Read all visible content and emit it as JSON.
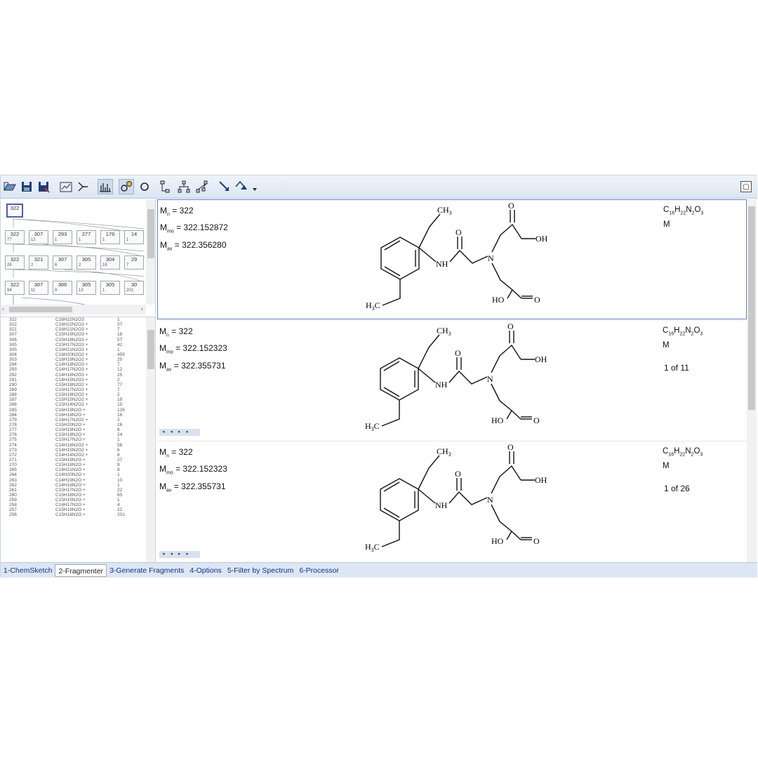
{
  "toolbar": {
    "icons": [
      "open-icon",
      "save-icon",
      "save-as-icon",
      "report-icon",
      "structure-icon",
      "spectrum-icon",
      "fragment-icon",
      "rotate-icon",
      "tree-icon",
      "hierarchy-icon",
      "network-icon",
      "arrow-down-icon",
      "arrow-tri-icon",
      "more-icon"
    ],
    "close_label": "▢"
  },
  "tree": {
    "root": "322",
    "rows": [
      [
        "322",
        "307",
        "293",
        "277",
        "176",
        "14"
      ],
      [
        "322",
        "321",
        "307",
        "305",
        "304",
        "29"
      ],
      [
        "322",
        "307",
        "306",
        "305",
        "305",
        "30"
      ]
    ],
    "subs": [
      [
        "77",
        "12",
        "1",
        "1",
        "1",
        "1"
      ],
      [
        "26",
        "2",
        "6",
        "2",
        "16",
        "7"
      ],
      [
        "94",
        "11",
        "9",
        "13",
        "1",
        "201"
      ]
    ]
  },
  "list": {
    "rows": [
      [
        "322",
        "C16H22N2O3",
        "1"
      ],
      [
        "322",
        "C16H22N2O3 +",
        "07"
      ],
      [
        "321",
        "C16H21N2O3 +",
        "7"
      ],
      [
        "307",
        "C15H19N2O3 +",
        "18"
      ],
      [
        "306",
        "C15H18N2O3 +",
        "57"
      ],
      [
        "305",
        "C15H17N2O3 +",
        "42"
      ],
      [
        "305",
        "C16H21N2O2 +",
        "1"
      ],
      [
        "304",
        "C16H20N2O2 +",
        "455"
      ],
      [
        "303",
        "C16H19N2O2 +",
        "25"
      ],
      [
        "294",
        "C14H18N2O3 +",
        "7"
      ],
      [
        "293",
        "C14H17N2O3 +",
        "12"
      ],
      [
        "292",
        "C14H16N2O3 +",
        "25"
      ],
      [
        "291",
        "C14H15N2O3 +",
        "2"
      ],
      [
        "290",
        "C15H18N2O2 +",
        "77"
      ],
      [
        "289",
        "C15H17N2O2 +",
        "7"
      ],
      [
        "288",
        "C15H16N2O2 +",
        "2"
      ],
      [
        "287",
        "C15H15N2O2 +",
        "19"
      ],
      [
        "286",
        "C15H14N2O2 +",
        "15"
      ],
      [
        "285",
        "C16H19N2O +",
        "126"
      ],
      [
        "284",
        "C16H18N2O +",
        "18"
      ],
      [
        "279",
        "C14H17N2O2 +",
        "2"
      ],
      [
        "278",
        "C15H20N2O +",
        "16"
      ],
      [
        "277",
        "C15H19N2O +",
        "6"
      ],
      [
        "276",
        "C15H18N2O +",
        "24"
      ],
      [
        "275",
        "C15H17N2O +",
        "1"
      ],
      [
        "274",
        "C14H16N2O2 +",
        "58"
      ],
      [
        "273",
        "C14H15N2O2 +",
        "6"
      ],
      [
        "272",
        "C14H14N2O2 +",
        "8"
      ],
      [
        "271",
        "C15H19N2O +",
        "27"
      ],
      [
        "270",
        "C15H18N2O +",
        "9"
      ],
      [
        "265",
        "C14H21N2O +",
        "8"
      ],
      [
        "264",
        "C14H20N2O +",
        "1"
      ],
      [
        "263",
        "C14H19N2O +",
        "10"
      ],
      [
        "262",
        "C14H18N2O +",
        "1"
      ],
      [
        "261",
        "C15H17N2O +",
        "22"
      ],
      [
        "260",
        "C15H16N2O +",
        "85"
      ],
      [
        "259",
        "C15H15N2O +",
        "1"
      ],
      [
        "258",
        "C14H17N2O +",
        "4"
      ],
      [
        "257",
        "C15H19N2O +",
        "22"
      ],
      [
        "256",
        "C15H18N2O +",
        "201"
      ]
    ]
  },
  "entries": [
    {
      "mass": {
        "n_label": "M",
        "n_sub": "n",
        "n_val": "= 322",
        "mo_label": "M",
        "mo_sub": "mo",
        "mo_val": "= 322.152872",
        "av_label": "M",
        "av_sub": "av",
        "av_val": "= 322.356280"
      },
      "formula": {
        "c": "C",
        "c_n": "16",
        "h": "H",
        "h_n": "22",
        "n": "N",
        "n_n": "2",
        "o": "O",
        "o_n": "3",
        "line2": "M"
      },
      "count": ""
    },
    {
      "mass": {
        "n_label": "M",
        "n_sub": "n",
        "n_val": "= 322",
        "mo_label": "M",
        "mo_sub": "mo",
        "mo_val": "= 322.152323",
        "av_label": "M",
        "av_sub": "av",
        "av_val": "= 322.355731"
      },
      "formula": {
        "c": "C",
        "c_n": "16",
        "h": "H",
        "h_n": "22",
        "n": "N",
        "n_n": "2",
        "o": "O",
        "o_n": "3",
        "line2": "M"
      },
      "count": "1 of 11"
    },
    {
      "mass": {
        "n_label": "M",
        "n_sub": "n",
        "n_val": "= 322",
        "mo_label": "M",
        "mo_sub": "mo",
        "mo_val": "= 322.152323",
        "av_label": "M",
        "av_sub": "av",
        "av_val": "= 322.355731"
      },
      "formula": {
        "c": "C",
        "c_n": "16",
        "h": "H",
        "h_n": "22",
        "n": "N",
        "n_n": "2",
        "o": "O",
        "o_n": "3",
        "line2": "M"
      },
      "count": "1 of 26"
    }
  ],
  "molecule": {
    "ch3": "CH",
    "ch3_sub": "3",
    "o": "O",
    "oh": "OH",
    "nh": "NH",
    "n": "N",
    "ho": "HO",
    "h3c": "H",
    "h3c_sub": "3",
    "h3c_c": "C",
    "c": "C"
  },
  "pager": "◂ ◂ ▸ ▸",
  "tabs": [
    "1-ChemSketch",
    "2-Fragmenter",
    "3-Generate Fragments",
    "4-Options",
    "5-Filter by Spectrum",
    "6-Processor"
  ]
}
